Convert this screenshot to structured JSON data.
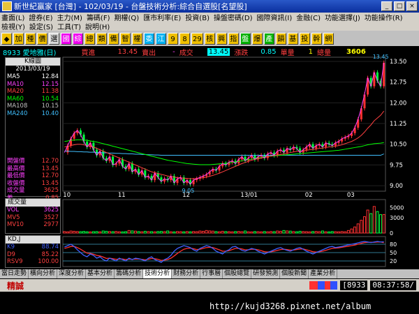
{
  "window": {
    "title": "新世紀贏家 [台灣] - 102/03/19 - 台盤技術分析:綜合自選股[名望股]"
  },
  "menu": {
    "row1": [
      "畫面(L)",
      "證券(E)",
      "主力(M)",
      "籌碼(F)",
      "期權(Q)",
      "匯市利率(E)",
      "投資(B)",
      "操盤密碼(D)",
      "國際資訊(I)",
      "金融(C)",
      "功能選擇(J)",
      "功能操作(R)"
    ],
    "row2": [
      "檢視(Y)",
      "設定(S)",
      "工具(T)",
      "說明(H)"
    ]
  },
  "toolbar": {
    "items": [
      {
        "label": "◆",
        "bg": "#f0c000",
        "fg": "#000"
      },
      {
        "label": "加",
        "bg": "#f0c000",
        "fg": "#000"
      },
      {
        "label": "種",
        "bg": "#f0c000",
        "fg": "#000"
      },
      {
        "label": "價",
        "bg": "#f0c000",
        "fg": "#000"
      },
      {
        "label": "選",
        "bg": "#d8d8d8",
        "fg": "#000"
      },
      {
        "label": "國",
        "bg": "#f000f0",
        "fg": "#fff"
      },
      {
        "label": "綜",
        "bg": "#f000f0",
        "fg": "#fff"
      },
      {
        "label": "總",
        "bg": "#f0c000",
        "fg": "#000"
      },
      {
        "label": "類",
        "bg": "#f0c000",
        "fg": "#000"
      },
      {
        "label": "備",
        "bg": "#f0c000",
        "fg": "#000"
      },
      {
        "label": "智",
        "bg": "#f0c000",
        "fg": "#000"
      },
      {
        "label": "權",
        "bg": "#f0c000",
        "fg": "#000"
      },
      {
        "label": "委",
        "bg": "#00b0f0",
        "fg": "#fff"
      },
      {
        "label": "江",
        "bg": "#00b0f0",
        "fg": "#fff"
      },
      {
        "label": "9",
        "bg": "#f0c000",
        "fg": "#000"
      },
      {
        "label": "8",
        "bg": "#f0c000",
        "fg": "#000"
      },
      {
        "label": "29",
        "bg": "#f0c000",
        "fg": "#000"
      },
      {
        "label": "核",
        "bg": "#f0c000",
        "fg": "#000"
      },
      {
        "label": "興",
        "bg": "#f0c000",
        "fg": "#000"
      },
      {
        "label": "指",
        "bg": "#f0c000",
        "fg": "#000"
      },
      {
        "label": "盤",
        "bg": "#00b000",
        "fg": "#fff"
      },
      {
        "label": "爆",
        "bg": "#f0c000",
        "fg": "#000"
      },
      {
        "label": "產",
        "bg": "#00b000",
        "fg": "#fff"
      },
      {
        "label": "韻",
        "bg": "#f0c000",
        "fg": "#000"
      },
      {
        "label": "基",
        "bg": "#f0c000",
        "fg": "#000"
      },
      {
        "label": "投",
        "bg": "#f0c000",
        "fg": "#000"
      },
      {
        "label": "幹",
        "bg": "#f0c000",
        "fg": "#000"
      },
      {
        "label": "網",
        "bg": "#f0c000",
        "fg": "#000"
      }
    ]
  },
  "info": {
    "stock": "8933 愛地雅(日)",
    "buy_label": "買進",
    "buy_value": "13.45",
    "sell_label": "賣出",
    "sell_value": "-",
    "trade_label": "成交",
    "trade_value": "13.45",
    "change_label": "漲跌",
    "change_value": "0.85",
    "lot_label": "單量",
    "lot_value": "1",
    "total_label": "總量",
    "total_value": "3606"
  },
  "legend": {
    "title": "K線圖",
    "date": "2013/03/19",
    "ma": [
      {
        "name": "MA5",
        "value": "12.84",
        "color": "#ffffff"
      },
      {
        "name": "MA10",
        "value": "12.15",
        "color": "#ff40ff"
      },
      {
        "name": "MA20",
        "value": "11.38",
        "color": "#ff4040"
      },
      {
        "name": "MA60",
        "value": "10.54",
        "color": "#00ff00"
      },
      {
        "name": "MA108",
        "value": "10.15",
        "color": "#c0c0c0"
      },
      {
        "name": "MA240",
        "value": "10.40",
        "color": "#40c0ff"
      }
    ],
    "prices": [
      {
        "name": "開盤價",
        "value": "12.70"
      },
      {
        "name": "最高價",
        "value": "13.45"
      },
      {
        "name": "最低價",
        "value": "12.70"
      },
      {
        "name": "收盤價",
        "value": "13.45"
      },
      {
        "name": "成交量",
        "value": "3625"
      },
      {
        "name": "差",
        "value": "0.85"
      }
    ]
  },
  "vol": {
    "title": "成交量",
    "rows": [
      {
        "name": "VOL",
        "value": "3625",
        "color": "#ff40ff"
      },
      {
        "name": "MV5",
        "value": "3527",
        "color": "#ff4040"
      },
      {
        "name": "MV10",
        "value": "2977",
        "color": "#ff4040"
      }
    ]
  },
  "kdj": {
    "title": "KD,J",
    "rows": [
      {
        "name": "K9",
        "value": "88.74",
        "color": "#4060ff"
      },
      {
        "name": "D9",
        "value": "85.22",
        "color": "#ff4040"
      },
      {
        "name": "RSV9",
        "value": "100.00",
        "color": "#ff4040"
      }
    ]
  },
  "chart_data": {
    "type": "line",
    "price_axis": {
      "ticks": [
        13.5,
        12.75,
        12.0,
        11.25,
        10.5,
        9.75,
        9.0
      ],
      "ylim": [
        8.85,
        13.6
      ]
    },
    "x_ticks": [
      "10",
      "11",
      "12",
      "13/01",
      "02",
      "03"
    ],
    "annotations": [
      {
        "text": "9.05"
      },
      {
        "text": "13.45"
      }
    ],
    "close": [
      10.2,
      10.45,
      10.7,
      10.9,
      11.0,
      10.85,
      10.6,
      10.4,
      10.55,
      10.3,
      10.1,
      10.25,
      10.0,
      9.9,
      10.05,
      9.75,
      9.8,
      9.95,
      9.7,
      9.6,
      9.8,
      9.5,
      9.6,
      9.4,
      9.55,
      9.3,
      9.35,
      9.2,
      9.45,
      9.3,
      9.15,
      9.25,
      9.2,
      9.35,
      9.1,
      9.25,
      9.3,
      9.1,
      9.2,
      9.05,
      9.2,
      9.25,
      9.3,
      9.35,
      9.4,
      9.5,
      9.6,
      9.55,
      9.7,
      9.8,
      9.75,
      9.85,
      9.9,
      9.8,
      9.95,
      10.05,
      9.9,
      10.0,
      10.1,
      9.95,
      10.05,
      10.1,
      10.0,
      10.15,
      10.2,
      10.1,
      10.25,
      10.3,
      10.2,
      10.35,
      10.3,
      10.4,
      10.35,
      10.2,
      10.3,
      10.4,
      10.5,
      10.35,
      10.45,
      10.5,
      10.4,
      10.55,
      10.5,
      10.45,
      10.55,
      10.6,
      10.7,
      10.75,
      10.8,
      10.9,
      11.1,
      11.4,
      11.8,
      12.3,
      12.9,
      12.6,
      13.1,
      12.8,
      12.6,
      13.45
    ],
    "ma20": [
      10.4,
      10.42,
      10.45,
      10.48,
      10.5,
      10.5,
      10.48,
      10.45,
      10.42,
      10.4,
      10.35,
      10.3,
      10.25,
      10.2,
      10.15,
      10.1,
      10.05,
      10.0,
      9.95,
      9.9,
      9.85,
      9.8,
      9.75,
      9.7,
      9.65,
      9.6,
      9.55,
      9.5,
      9.47,
      9.44,
      9.41,
      9.38,
      9.35,
      9.33,
      9.31,
      9.29,
      9.28,
      9.27,
      9.26,
      9.25,
      9.25,
      9.26,
      9.27,
      9.29,
      9.31,
      9.34,
      9.37,
      9.41,
      9.45,
      9.5,
      9.55,
      9.6,
      9.65,
      9.7,
      9.75,
      9.8,
      9.84,
      9.88,
      9.92,
      9.95,
      9.98,
      10.0,
      10.02,
      10.05,
      10.07,
      10.09,
      10.11,
      10.13,
      10.15,
      10.17,
      10.2,
      10.22,
      10.24,
      10.25,
      10.26,
      10.28,
      10.3,
      10.31,
      10.33,
      10.35,
      10.36,
      10.38,
      10.4,
      10.41,
      10.43,
      10.45,
      10.48,
      10.52,
      10.56,
      10.6,
      10.66,
      10.73,
      10.82,
      10.94,
      11.08,
      11.2,
      11.35,
      11.45,
      11.55,
      11.7
    ],
    "ma60": [
      10.6,
      10.62,
      10.64,
      10.65,
      10.66,
      10.66,
      10.65,
      10.64,
      10.62,
      10.6,
      10.58,
      10.55,
      10.52,
      10.49,
      10.46,
      10.43,
      10.4,
      10.37,
      10.34,
      10.31,
      10.28,
      10.25,
      10.22,
      10.19,
      10.16,
      10.13,
      10.1,
      10.07,
      10.04,
      10.01,
      9.98,
      9.95,
      9.92,
      9.9,
      9.88,
      9.86,
      9.84,
      9.82,
      9.8,
      9.79,
      9.78,
      9.77,
      9.76,
      9.76,
      9.76,
      9.76,
      9.77,
      9.78,
      9.79,
      9.8,
      9.81,
      9.82,
      9.84,
      9.86,
      9.88,
      9.9,
      9.92,
      9.94,
      9.96,
      9.98,
      10.0,
      10.02,
      10.04,
      10.05,
      10.07,
      10.08,
      10.09,
      10.1,
      10.11,
      10.12,
      10.13,
      10.14,
      10.15,
      10.16,
      10.17,
      10.18,
      10.19,
      10.2,
      10.21,
      10.22,
      10.23,
      10.24,
      10.25,
      10.26,
      10.27,
      10.28,
      10.3,
      10.32,
      10.34,
      10.36,
      10.38,
      10.4,
      10.42,
      10.45,
      10.48,
      10.5,
      10.52,
      10.53,
      10.54,
      10.56
    ],
    "ma240": [
      10.25,
      10.25,
      10.24,
      10.24,
      10.23,
      10.23,
      10.22,
      10.22,
      10.21,
      10.21,
      10.2,
      10.2,
      10.19,
      10.19,
      10.18,
      10.18,
      10.17,
      10.17,
      10.16,
      10.16,
      10.15,
      10.15,
      10.14,
      10.14,
      10.13,
      10.13,
      10.12,
      10.12,
      10.11,
      10.11,
      10.1,
      10.1,
      10.1,
      10.1,
      10.1,
      10.1,
      10.1,
      10.1,
      10.1,
      10.1,
      10.1,
      10.1,
      10.1,
      10.1,
      10.1,
      10.1,
      10.1,
      10.1,
      10.1,
      10.1,
      10.1,
      10.1,
      10.1,
      10.1,
      10.1,
      10.1,
      10.1,
      10.1,
      10.1,
      10.1,
      10.1,
      10.1,
      10.1,
      10.1,
      10.1,
      10.1,
      10.1,
      10.1,
      10.1,
      10.1,
      10.1,
      10.1,
      10.1,
      10.1,
      10.1,
      10.1,
      10.1,
      10.1,
      10.1,
      10.1,
      10.1,
      10.1,
      10.1,
      10.1,
      10.1,
      10.1,
      10.1,
      10.1,
      10.1,
      10.1,
      10.1,
      10.1,
      10.1,
      10.1,
      10.1,
      10.1,
      10.1,
      10.1,
      10.1,
      10.15
    ],
    "volume_axis": {
      "ticks": [
        5000,
        3000,
        0
      ],
      "ylim": [
        0,
        6000
      ]
    },
    "volume": [
      300,
      250,
      400,
      350,
      300,
      280,
      320,
      260,
      240,
      280,
      300,
      250,
      400,
      350,
      300,
      280,
      320,
      260,
      240,
      280,
      500,
      420,
      380,
      300,
      260,
      350,
      300,
      280,
      250,
      300,
      320,
      280,
      400,
      260,
      240,
      300,
      280,
      250,
      300,
      260,
      300,
      280,
      400,
      350,
      500,
      420,
      380,
      300,
      260,
      350,
      300,
      280,
      250,
      300,
      320,
      280,
      400,
      260,
      240,
      300,
      280,
      250,
      300,
      260,
      300,
      280,
      400,
      350,
      500,
      420,
      380,
      300,
      260,
      350,
      300,
      280,
      250,
      300,
      320,
      280,
      400,
      260,
      240,
      300,
      280,
      250,
      300,
      260,
      500,
      800,
      1200,
      1800,
      2500,
      3200,
      4500,
      3800,
      5200,
      4200,
      3600,
      3625
    ],
    "kd_axis": {
      "ticks": [
        80,
        50,
        20
      ],
      "ylim": [
        0,
        100
      ]
    },
    "k9": [
      70,
      75,
      80,
      72,
      60,
      50,
      40,
      35,
      45,
      40,
      30,
      35,
      25,
      20,
      30,
      25,
      20,
      30,
      25,
      20,
      30,
      25,
      30,
      28,
      25,
      20,
      30,
      35,
      25,
      20,
      15,
      25,
      30,
      40,
      55,
      65,
      70,
      75,
      72,
      68,
      60,
      55,
      65,
      70,
      75,
      72,
      65,
      55,
      50,
      45,
      55,
      60,
      70,
      72,
      65,
      58,
      55,
      60,
      65,
      62,
      55,
      50,
      45,
      50,
      55,
      60,
      65,
      68,
      62,
      58,
      55,
      60,
      65,
      68,
      62,
      55,
      50,
      45,
      50,
      55,
      60,
      65,
      70,
      72,
      68,
      70,
      72,
      75,
      78,
      80,
      82,
      85,
      88,
      90,
      88,
      86,
      88,
      90,
      88,
      88.74
    ],
    "d9": [
      65,
      68,
      72,
      72,
      68,
      62,
      55,
      48,
      47,
      44,
      40,
      38,
      34,
      29,
      30,
      28,
      26,
      27,
      27,
      25,
      27,
      26,
      27,
      27,
      26,
      24,
      26,
      29,
      28,
      26,
      22,
      23,
      25,
      30,
      38,
      47,
      55,
      62,
      65,
      66,
      64,
      61,
      62,
      65,
      68,
      69,
      68,
      64,
      60,
      55,
      55,
      57,
      61,
      65,
      65,
      63,
      60,
      60,
      62,
      62,
      60,
      57,
      53,
      52,
      53,
      55,
      58,
      61,
      62,
      61,
      59,
      59,
      61,
      63,
      63,
      60,
      57,
      53,
      52,
      53,
      55,
      58,
      62,
      65,
      66,
      67,
      69,
      71,
      73,
      75,
      77,
      80,
      83,
      86,
      87,
      87,
      87,
      88,
      88,
      85.22
    ]
  },
  "tabs": [
    {
      "label": "當日走勢",
      "active": false
    },
    {
      "label": "橫向分析",
      "active": false
    },
    {
      "label": "深度分析",
      "active": false
    },
    {
      "label": "基本分析",
      "active": false
    },
    {
      "label": "籌碼分析",
      "active": false
    },
    {
      "label": "技術分析",
      "active": true
    },
    {
      "label": "財務分析",
      "active": false
    },
    {
      "label": "行事曆",
      "active": false
    },
    {
      "label": "個股總覽",
      "active": false
    },
    {
      "label": "研發預測",
      "active": false
    },
    {
      "label": "個股新聞",
      "active": false
    },
    {
      "label": "產業分析",
      "active": false
    }
  ],
  "status": {
    "label": "精誠",
    "code": "[8933",
    "time": "08:37:58/"
  },
  "watermark": "http://kujd3268.pixnet.net/album"
}
